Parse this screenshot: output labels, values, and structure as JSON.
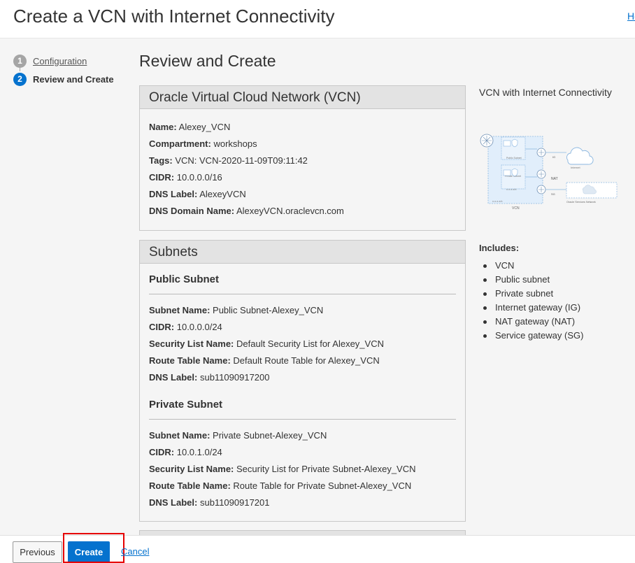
{
  "header": {
    "title": "Create a VCN with Internet Connectivity",
    "help_link": "Help"
  },
  "steps": [
    {
      "number": "1",
      "label": "Configuration",
      "state": "completed"
    },
    {
      "number": "2",
      "label": "Review and Create",
      "state": "current"
    }
  ],
  "main": {
    "title": "Review and Create",
    "vcn_panel": {
      "title": "Oracle Virtual Cloud Network (VCN)",
      "fields": [
        {
          "key": "Name:",
          "value": "Alexey_VCN"
        },
        {
          "key": "Compartment:",
          "value": "workshops"
        },
        {
          "key": "Tags:",
          "value": "VCN: VCN-2020-11-09T09:11:42"
        },
        {
          "key": "CIDR:",
          "value": "10.0.0.0/16"
        },
        {
          "key": "DNS Label:",
          "value": "AlexeyVCN"
        },
        {
          "key": "DNS Domain Name:",
          "value": "AlexeyVCN.oraclevcn.com"
        }
      ]
    },
    "subnets_panel": {
      "title": "Subnets",
      "public": {
        "title": "Public Subnet",
        "fields": [
          {
            "key": "Subnet Name:",
            "value": "Public Subnet-Alexey_VCN"
          },
          {
            "key": "CIDR:",
            "value": "10.0.0.0/24"
          },
          {
            "key": "Security List Name:",
            "value": "Default Security List for Alexey_VCN"
          },
          {
            "key": "Route Table Name:",
            "value": "Default Route Table for Alexey_VCN"
          },
          {
            "key": "DNS Label:",
            "value": "sub11090917200"
          }
        ]
      },
      "private": {
        "title": "Private Subnet",
        "fields": [
          {
            "key": "Subnet Name:",
            "value": "Private Subnet-Alexey_VCN"
          },
          {
            "key": "CIDR:",
            "value": "10.0.1.0/24"
          },
          {
            "key": "Security List Name:",
            "value": "Security List for Private Subnet-Alexey_VCN"
          },
          {
            "key": "Route Table Name:",
            "value": "Route Table for Private Subnet-Alexey_VCN"
          },
          {
            "key": "DNS Label:",
            "value": "sub11090917201"
          }
        ]
      }
    }
  },
  "aside": {
    "diagram_title": "VCN with Internet Connectivity",
    "diagram_labels": {
      "vcn": "VCN",
      "ig": "IG",
      "nat": "NAT",
      "sg": "SG",
      "internet": "Internet",
      "osn": "Oracle Services Network",
      "public_subnet": "Public Subnet",
      "private_subnet": "Private Subnet",
      "xxxx1": "x.x.x.x/x",
      "xxxx2": "x.x.x.x/x",
      "xxxx3": "x.x.x.x/x"
    },
    "includes_label": "Includes:",
    "includes": [
      "VCN",
      "Public subnet",
      "Private subnet",
      "Internet gateway (IG)",
      "NAT gateway (NAT)",
      "Service gateway (SG)"
    ]
  },
  "footer": {
    "previous": "Previous",
    "create": "Create",
    "cancel": "Cancel"
  },
  "colors": {
    "primary": "#0572ce",
    "highlight": "#e60000"
  }
}
